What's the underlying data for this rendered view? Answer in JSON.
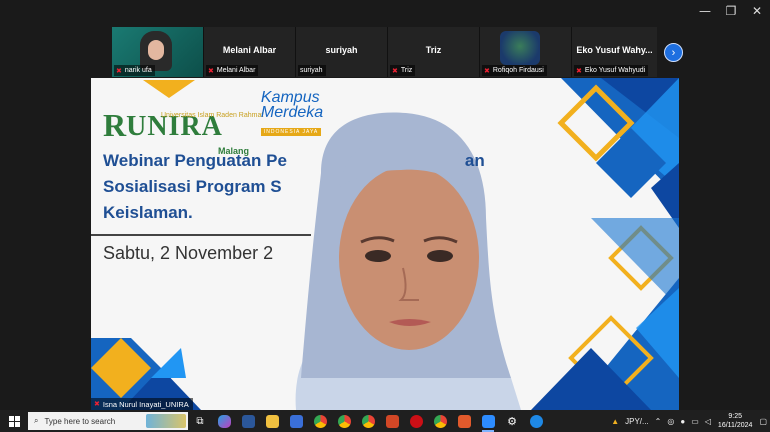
{
  "window_controls": {
    "minimize": "—",
    "maximize": "❐",
    "close": "✕"
  },
  "participants": [
    {
      "tile_name": "",
      "label": "narik ufa"
    },
    {
      "tile_name": "Melani Albar",
      "label": "Melani Albar"
    },
    {
      "tile_name": "suriyah",
      "label": "suriyah"
    },
    {
      "tile_name": "Triz",
      "label": "Triz"
    },
    {
      "tile_name": "",
      "label": "Rofiqoh Firdausi"
    },
    {
      "tile_name": "Eko Yusuf Wahy...",
      "label": "Eko Yusuf Wahyudi"
    }
  ],
  "next_page": "›",
  "slide": {
    "unira_sub": "Universitas Islam Raden Rahmat",
    "unira_text": "UNIRA",
    "unira_malang": "Malang",
    "kampus_line1": "Kampus",
    "kampus_line2": "Merdeka",
    "kampus_tag": "INDONESIA JAYA",
    "title_line1": "Webinar Penguatan Pe",
    "title_line1_tail": "an",
    "title_line2": "Sosialisasi Program S",
    "title_line3": "Keislaman.",
    "date": "Sabtu, 2 November 2"
  },
  "speaker_label": "Isna Nurul Inayati_UNIRA",
  "taskbar": {
    "search_placeholder": "Type here to search",
    "tray_text": "JPY/...",
    "time": "9:25",
    "date": "16/11/2024"
  },
  "colors": {
    "accent_blue": "#1e6fe0",
    "slide_title": "#1f4f94",
    "unira_green": "#2f7d3c",
    "geo_blue": "#1565c0",
    "geo_yellow": "#f2b01e"
  }
}
